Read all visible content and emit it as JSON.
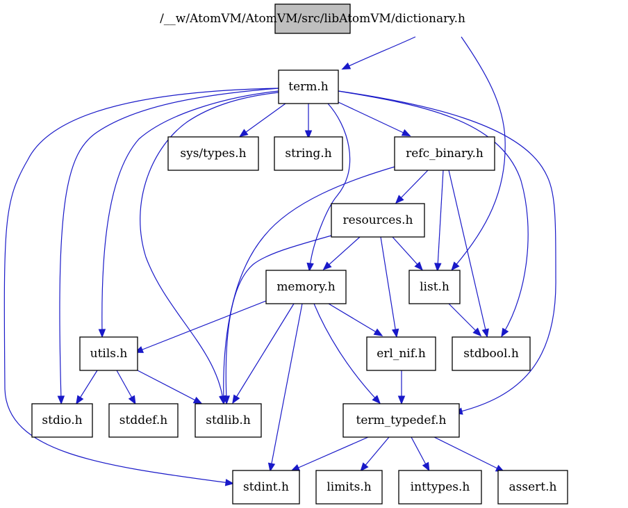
{
  "title": "/__w/AtomVM/AtomVM/src/libAtomVM/dictionary.h",
  "colors": {
    "edge": "#1919c8",
    "root_fill": "#bfbfbf",
    "node_fill": "#ffffff",
    "node_stroke": "#000000"
  },
  "nodes": [
    {
      "id": "dictionary_h",
      "label": "/__w/AtomVM/AtomVM/src/libAtomVM/dictionary.h",
      "root": true
    },
    {
      "id": "term_h",
      "label": "term.h"
    },
    {
      "id": "sys_types_h",
      "label": "sys/types.h"
    },
    {
      "id": "string_h",
      "label": "string.h"
    },
    {
      "id": "refc_binary_h",
      "label": "refc_binary.h"
    },
    {
      "id": "resources_h",
      "label": "resources.h"
    },
    {
      "id": "memory_h",
      "label": "memory.h"
    },
    {
      "id": "list_h",
      "label": "list.h"
    },
    {
      "id": "utils_h",
      "label": "utils.h"
    },
    {
      "id": "erl_nif_h",
      "label": "erl_nif.h"
    },
    {
      "id": "stdbool_h",
      "label": "stdbool.h"
    },
    {
      "id": "stdio_h",
      "label": "stdio.h"
    },
    {
      "id": "stddef_h",
      "label": "stddef.h"
    },
    {
      "id": "stdlib_h",
      "label": "stdlib.h"
    },
    {
      "id": "term_typedef_h",
      "label": "term_typedef.h"
    },
    {
      "id": "stdint_h",
      "label": "stdint.h"
    },
    {
      "id": "limits_h",
      "label": "limits.h"
    },
    {
      "id": "inttypes_h",
      "label": "inttypes.h"
    },
    {
      "id": "assert_h",
      "label": "assert.h"
    }
  ],
  "edges": [
    {
      "from": "dictionary_h",
      "to": "term_h"
    },
    {
      "from": "dictionary_h",
      "to": "list_h"
    },
    {
      "from": "term_h",
      "to": "sys_types_h"
    },
    {
      "from": "term_h",
      "to": "string_h"
    },
    {
      "from": "term_h",
      "to": "refc_binary_h"
    },
    {
      "from": "term_h",
      "to": "memory_h"
    },
    {
      "from": "term_h",
      "to": "utils_h"
    },
    {
      "from": "term_h",
      "to": "stdio_h"
    },
    {
      "from": "term_h",
      "to": "stdlib_h"
    },
    {
      "from": "term_h",
      "to": "stdint_h"
    },
    {
      "from": "term_h",
      "to": "stdbool_h"
    },
    {
      "from": "term_h",
      "to": "term_typedef_h"
    },
    {
      "from": "refc_binary_h",
      "to": "resources_h"
    },
    {
      "from": "refc_binary_h",
      "to": "list_h"
    },
    {
      "from": "refc_binary_h",
      "to": "stdbool_h"
    },
    {
      "from": "refc_binary_h",
      "to": "stdlib_h"
    },
    {
      "from": "resources_h",
      "to": "memory_h"
    },
    {
      "from": "resources_h",
      "to": "list_h"
    },
    {
      "from": "resources_h",
      "to": "erl_nif_h"
    },
    {
      "from": "resources_h",
      "to": "stdlib_h"
    },
    {
      "from": "memory_h",
      "to": "utils_h"
    },
    {
      "from": "memory_h",
      "to": "erl_nif_h"
    },
    {
      "from": "memory_h",
      "to": "stdlib_h"
    },
    {
      "from": "memory_h",
      "to": "stdint_h"
    },
    {
      "from": "memory_h",
      "to": "term_typedef_h"
    },
    {
      "from": "list_h",
      "to": "stdbool_h"
    },
    {
      "from": "utils_h",
      "to": "stdio_h"
    },
    {
      "from": "utils_h",
      "to": "stddef_h"
    },
    {
      "from": "utils_h",
      "to": "stdlib_h"
    },
    {
      "from": "erl_nif_h",
      "to": "term_typedef_h"
    },
    {
      "from": "term_typedef_h",
      "to": "stdint_h"
    },
    {
      "from": "term_typedef_h",
      "to": "limits_h"
    },
    {
      "from": "term_typedef_h",
      "to": "inttypes_h"
    },
    {
      "from": "term_typedef_h",
      "to": "assert_h"
    }
  ]
}
